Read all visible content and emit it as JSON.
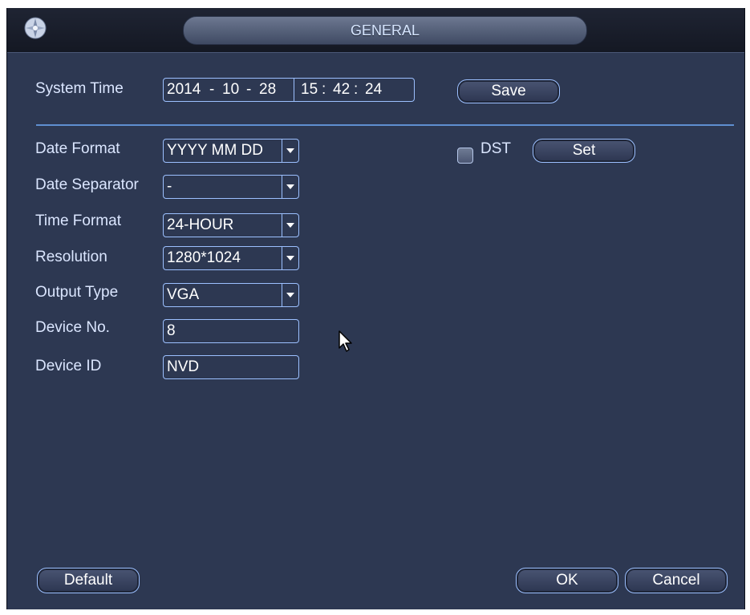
{
  "window": {
    "title": "GENERAL"
  },
  "system_time": {
    "label": "System Time",
    "year": "2014",
    "month": "10",
    "day": "28",
    "hour": "15",
    "minute": "42",
    "second": "24",
    "date_sep": "-",
    "time_sep": ":",
    "save_label": "Save"
  },
  "fields": {
    "date_format": {
      "label": "Date Format",
      "value": "YYYY MM DD"
    },
    "date_separator": {
      "label": "Date Separator",
      "value": "-"
    },
    "time_format": {
      "label": "Time Format",
      "value": "24-HOUR"
    },
    "resolution": {
      "label": "Resolution",
      "value": "1280*1024"
    },
    "output_type": {
      "label": "Output Type",
      "value": "VGA"
    },
    "device_no": {
      "label": "Device No.",
      "value": "8"
    },
    "device_id": {
      "label": "Device ID",
      "value": "NVD"
    }
  },
  "dst": {
    "label": "DST",
    "checked": false,
    "set_label": "Set"
  },
  "footer": {
    "default_label": "Default",
    "ok_label": "OK",
    "cancel_label": "Cancel"
  },
  "colors": {
    "panel": "#2d3852",
    "accent": "#9cc0ff",
    "label": "#dbe6ff",
    "divider": "#5f8fd1"
  }
}
